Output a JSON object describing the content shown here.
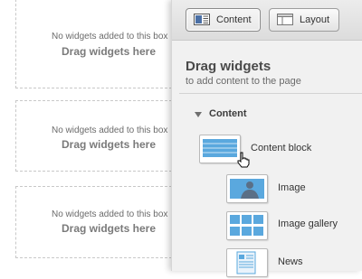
{
  "dropzones": [
    {
      "message": "No widgets added to this box",
      "title": "Drag widgets here"
    },
    {
      "message": "No widgets added to this box",
      "title": "Drag widgets here"
    },
    {
      "message": "No widgets added to this box",
      "title": "Drag widgets here"
    }
  ],
  "toolbar": {
    "content_label": "Content",
    "layout_label": "Layout",
    "active_tab": "Content"
  },
  "panel": {
    "heading": "Drag widgets",
    "subheading": "to add content to the page",
    "section": {
      "label": "Content",
      "expanded": true,
      "widgets": [
        {
          "label": "Content block",
          "icon": "content-block-icon"
        },
        {
          "label": "Image",
          "icon": "image-icon"
        },
        {
          "label": "Image gallery",
          "icon": "image-gallery-icon"
        },
        {
          "label": "News",
          "icon": "news-icon"
        }
      ]
    }
  },
  "colors": {
    "accent_blue": "#5aa8de",
    "panel_bg": "#f1f1f1",
    "dashed_border": "#c8c8c8"
  }
}
